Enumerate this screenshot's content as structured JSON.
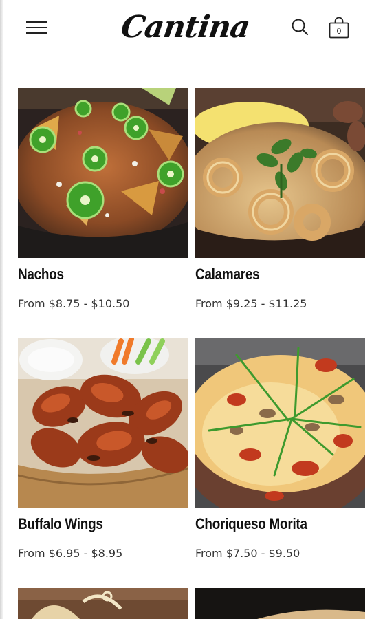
{
  "header": {
    "logo_text": "Cantina",
    "menu_icon": "hamburger-menu-icon",
    "search_icon": "search-icon",
    "cart_icon": "shopping-bag-icon",
    "cart_count": "0"
  },
  "products": [
    {
      "name": "Nachos",
      "price": "From $8.75 - $10.50"
    },
    {
      "name": "Calamares",
      "price": "From $9.25 - $11.25"
    },
    {
      "name": "Buffalo Wings",
      "price": "From $6.95 - $8.95"
    },
    {
      "name": "Choriqueso Morita",
      "price": "From $7.50 - $9.50"
    }
  ]
}
